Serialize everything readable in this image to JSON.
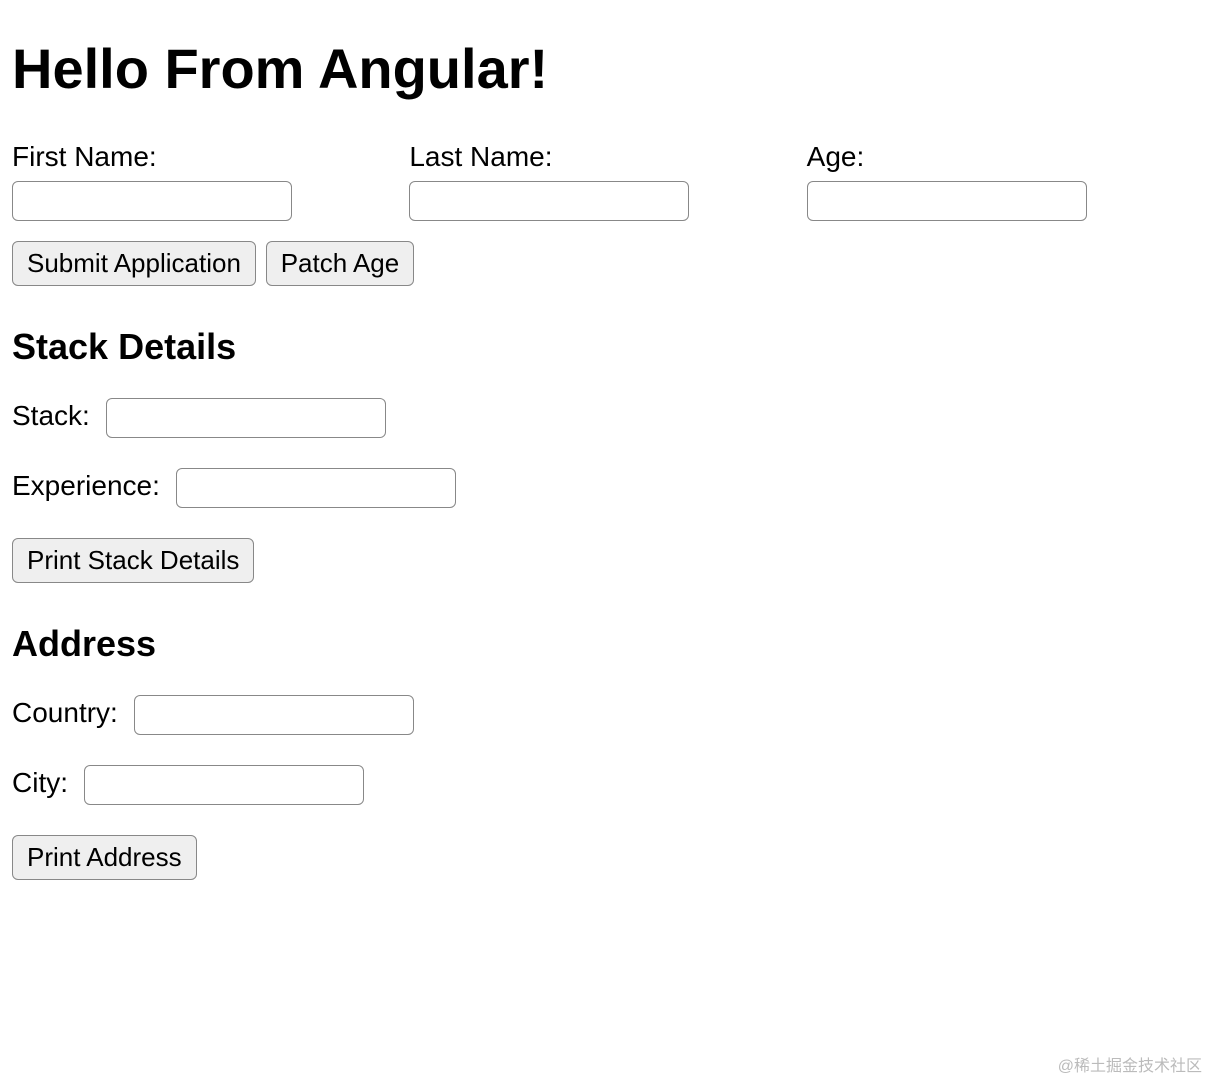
{
  "title": "Hello From Angular!",
  "form": {
    "firstName": {
      "label": "First Name:",
      "value": ""
    },
    "lastName": {
      "label": "Last Name:",
      "value": ""
    },
    "age": {
      "label": "Age:",
      "value": ""
    }
  },
  "buttons": {
    "submit": "Submit Application",
    "patchAge": "Patch Age",
    "printStack": "Print Stack Details",
    "printAddress": "Print Address"
  },
  "stackDetails": {
    "heading": "Stack Details",
    "stack": {
      "label": "Stack:",
      "value": ""
    },
    "experience": {
      "label": "Experience:",
      "value": ""
    }
  },
  "address": {
    "heading": "Address",
    "country": {
      "label": "Country:",
      "value": ""
    },
    "city": {
      "label": "City:",
      "value": ""
    }
  },
  "watermark": "@稀土掘金技术社区"
}
